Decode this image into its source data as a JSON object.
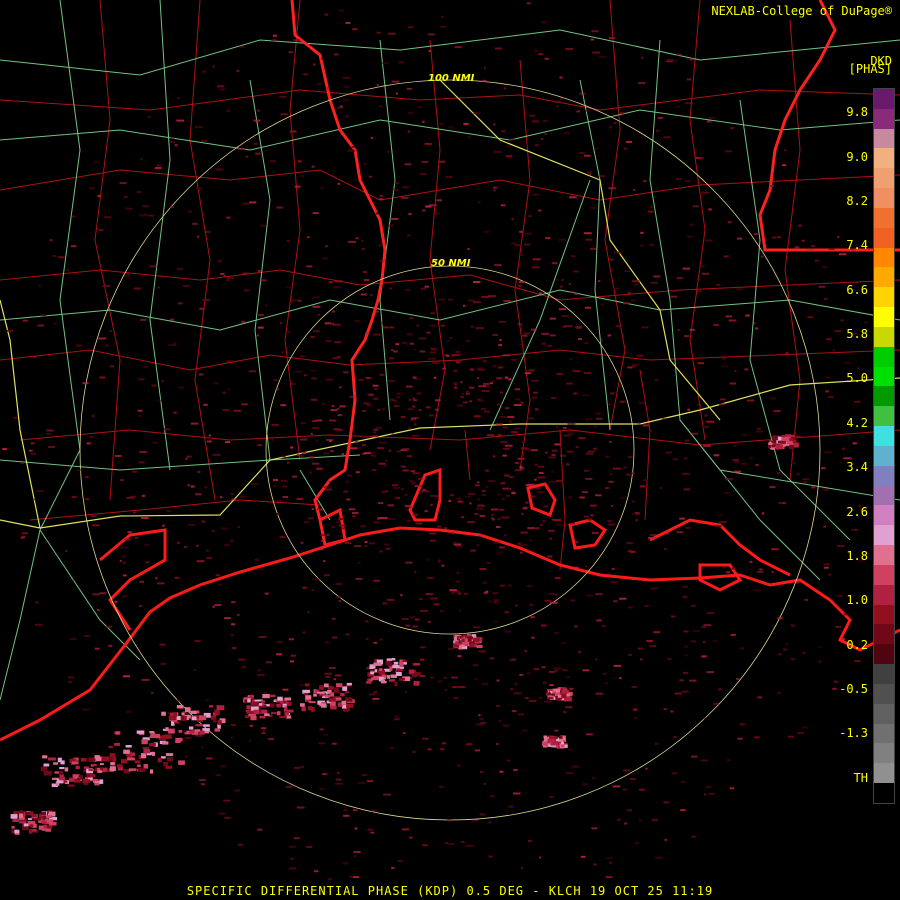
{
  "header": {
    "credit": "NEXLAB-College of DuPage",
    "product_code": "DKD",
    "units": "[PHAS]"
  },
  "footer": {
    "caption": "SPECIFIC DIFFERENTIAL PHASE (KDP) 0.5 DEG - KLCH 19 OCT 25 11:19"
  },
  "range_rings": {
    "inner_label": "50 NMI",
    "outer_label": "100 NMI"
  },
  "colorbar": {
    "ticks": [
      "9.8",
      "9.0",
      "8.2",
      "7.4",
      "6.6",
      "5.8",
      "5.0",
      "4.2",
      "3.4",
      "2.6",
      "1.8",
      "1.0",
      "0.2",
      "-0.5",
      "-1.3",
      "TH"
    ],
    "colors": [
      "#6a1a6a",
      "#8a2a7a",
      "#c888a0",
      "#f0b080",
      "#f0a070",
      "#f09060",
      "#f07030",
      "#f06020",
      "#ff8800",
      "#ffaa00",
      "#ffd400",
      "#ffff00",
      "#c8d800",
      "#00cc00",
      "#00e000",
      "#009900",
      "#40c040",
      "#40e0e0",
      "#60b0d0",
      "#8080c0",
      "#a070b0",
      "#d080c0",
      "#e0a0d0",
      "#e07090",
      "#d04060",
      "#b02040",
      "#901020",
      "#700818",
      "#500410",
      "#404040",
      "#505050",
      "#606060",
      "#707070",
      "#808080",
      "#909090",
      "#000000"
    ]
  },
  "colors": {
    "state_border": "#ff2020",
    "county_line": "#b01010",
    "highway": "#80d890",
    "interstate": "#e0e060",
    "coast": "#ff1a1a",
    "ring": "#e0d890",
    "accent_text": "#ffff00"
  }
}
